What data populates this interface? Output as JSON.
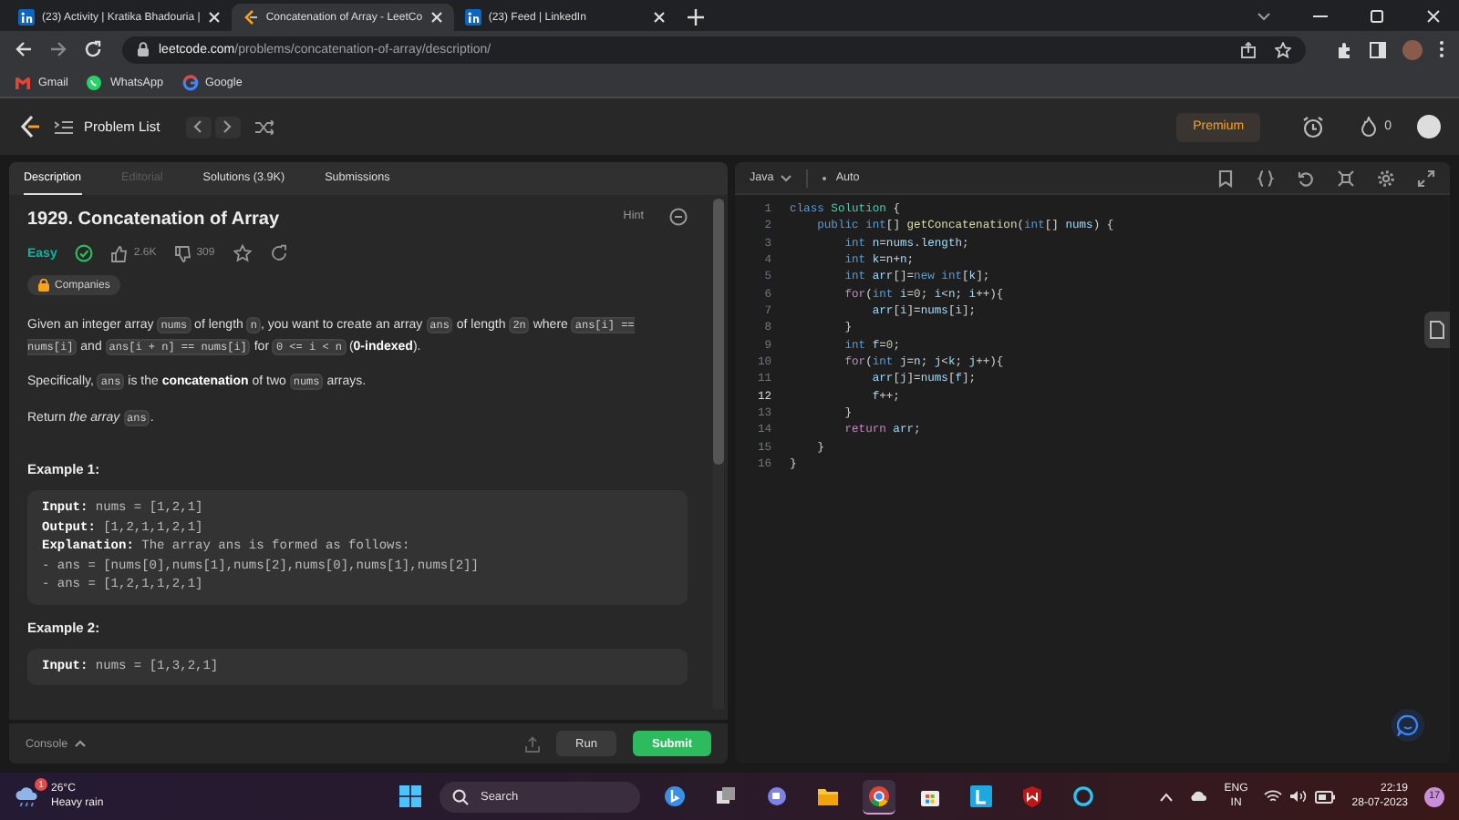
{
  "browser": {
    "tabs": [
      {
        "title": "(23) Activity | Kratika Bhadouria |",
        "kind": "linkedin",
        "selected": false
      },
      {
        "title": "Concatenation of Array - LeetCo",
        "kind": "leetcode",
        "selected": true
      },
      {
        "title": "(23) Feed | LinkedIn",
        "kind": "linkedin",
        "selected": false
      }
    ],
    "url": {
      "host": "leetcode.com",
      "path": "/problems/concatenation-of-array/description/"
    },
    "bookmarks": [
      {
        "label": "Gmail",
        "kind": "gmail"
      },
      {
        "label": "WhatsApp",
        "kind": "whatsapp"
      },
      {
        "label": "Google",
        "kind": "google"
      }
    ]
  },
  "nav": {
    "problem_list": "Problem List",
    "premium": "Premium",
    "streak": "0"
  },
  "left_tabs": [
    {
      "label": "Description",
      "selected": true,
      "disabled": false
    },
    {
      "label": "Editorial",
      "selected": false,
      "disabled": true
    },
    {
      "label": "Solutions (3.9K)",
      "selected": false,
      "disabled": false
    },
    {
      "label": "Submissions",
      "selected": false,
      "disabled": false
    }
  ],
  "problem": {
    "title": "1929. Concatenation of Array",
    "hint": "Hint",
    "difficulty": "Easy",
    "solved": true,
    "likes": "2.6K",
    "dislikes": "309",
    "companies": "Companies",
    "paragraphs": [
      [
        {
          "kind": "text",
          "text": "Given an integer array "
        },
        {
          "kind": "code",
          "text": "nums"
        },
        {
          "kind": "text",
          "text": " of length "
        },
        {
          "kind": "code",
          "text": "n"
        },
        {
          "kind": "text",
          "text": ", you want to create an array "
        },
        {
          "kind": "code",
          "text": "ans"
        },
        {
          "kind": "text",
          "text": " of length "
        },
        {
          "kind": "code",
          "text": "2n"
        },
        {
          "kind": "text",
          "text": " where "
        },
        {
          "kind": "code",
          "text": "ans[i] == nums[i]"
        },
        {
          "kind": "text",
          "text": " and "
        },
        {
          "kind": "code",
          "text": "ans[i + n] == nums[i]"
        },
        {
          "kind": "text",
          "text": " for "
        },
        {
          "kind": "code",
          "text": "0 <= i < n"
        },
        {
          "kind": "text",
          "text": " ("
        },
        {
          "kind": "bold",
          "text": "0-indexed"
        },
        {
          "kind": "text",
          "text": ")."
        }
      ],
      [
        {
          "kind": "text",
          "text": "Specifically, "
        },
        {
          "kind": "code",
          "text": "ans"
        },
        {
          "kind": "text",
          "text": " is the "
        },
        {
          "kind": "bold",
          "text": "concatenation"
        },
        {
          "kind": "text",
          "text": " of two "
        },
        {
          "kind": "code",
          "text": "nums"
        },
        {
          "kind": "text",
          "text": " arrays."
        }
      ],
      [
        {
          "kind": "text",
          "text": "Return "
        },
        {
          "kind": "italic",
          "text": "the array "
        },
        {
          "kind": "code",
          "text": "ans"
        },
        {
          "kind": "text",
          "text": "."
        }
      ]
    ],
    "examples": [
      {
        "title": "Example 1:",
        "lines": [
          {
            "label": "Input:",
            "text": "nums = [1,2,1]"
          },
          {
            "label": "Output:",
            "text": "[1,2,1,1,2,1]"
          },
          {
            "label": "Explanation:",
            "text": "The array ans is formed as follows:"
          },
          {
            "text": "- ans = [nums[0],nums[1],nums[2],nums[0],nums[1],nums[2]]"
          },
          {
            "text": "- ans = [1,2,1,1,2,1]"
          }
        ]
      },
      {
        "title": "Example 2:",
        "lines": [
          {
            "label": "Input:",
            "text": "nums = [1,3,2,1]"
          }
        ]
      }
    ]
  },
  "console": {
    "label": "Console",
    "run": "Run",
    "submit": "Submit"
  },
  "editor": {
    "language": "Java",
    "mode": "Auto",
    "lines": [
      {
        "number": "1",
        "current": false,
        "tokens": [
          {
            "kind": "keyword",
            "text": "class"
          },
          {
            "kind": "type",
            "text": " Solution"
          },
          {
            "kind": "plain",
            "text": " {"
          }
        ]
      },
      {
        "number": "2",
        "current": false,
        "tokens": [
          {
            "kind": "keyword",
            "text": "    public"
          },
          {
            "kind": "keyword",
            "text": " int"
          },
          {
            "kind": "plain",
            "text": "[] "
          },
          {
            "kind": "function",
            "text": "getConcatenation"
          },
          {
            "kind": "plain",
            "text": "("
          },
          {
            "kind": "keyword",
            "text": "int"
          },
          {
            "kind": "plain",
            "text": "[] "
          },
          {
            "kind": "variable",
            "text": "nums"
          },
          {
            "kind": "plain",
            "text": ") {"
          }
        ]
      },
      {
        "number": "3",
        "current": false,
        "tokens": [
          {
            "kind": "keyword",
            "text": "        int"
          },
          {
            "kind": "variable",
            "text": " n"
          },
          {
            "kind": "plain",
            "text": "="
          },
          {
            "kind": "variable",
            "text": "nums"
          },
          {
            "kind": "plain",
            "text": "."
          },
          {
            "kind": "variable",
            "text": "length"
          },
          {
            "kind": "plain",
            "text": ";"
          }
        ]
      },
      {
        "number": "4",
        "current": false,
        "tokens": [
          {
            "kind": "keyword",
            "text": "        int"
          },
          {
            "kind": "variable",
            "text": " k"
          },
          {
            "kind": "plain",
            "text": "="
          },
          {
            "kind": "variable",
            "text": "n"
          },
          {
            "kind": "plain",
            "text": "+"
          },
          {
            "kind": "variable",
            "text": "n"
          },
          {
            "kind": "plain",
            "text": ";"
          }
        ]
      },
      {
        "number": "5",
        "current": false,
        "tokens": [
          {
            "kind": "keyword",
            "text": "        int"
          },
          {
            "kind": "variable",
            "text": " arr"
          },
          {
            "kind": "plain",
            "text": "[]="
          },
          {
            "kind": "keyword",
            "text": "new"
          },
          {
            "kind": "keyword",
            "text": " int"
          },
          {
            "kind": "plain",
            "text": "["
          },
          {
            "kind": "variable",
            "text": "k"
          },
          {
            "kind": "plain",
            "text": "];"
          }
        ]
      },
      {
        "number": "6",
        "current": false,
        "tokens": [
          {
            "kind": "control",
            "text": "        for"
          },
          {
            "kind": "plain",
            "text": "("
          },
          {
            "kind": "keyword",
            "text": "int"
          },
          {
            "kind": "variable",
            "text": " i"
          },
          {
            "kind": "plain",
            "text": "="
          },
          {
            "kind": "number",
            "text": "0"
          },
          {
            "kind": "plain",
            "text": "; "
          },
          {
            "kind": "variable",
            "text": "i"
          },
          {
            "kind": "plain",
            "text": "<"
          },
          {
            "kind": "variable",
            "text": "n"
          },
          {
            "kind": "plain",
            "text": "; "
          },
          {
            "kind": "variable",
            "text": "i"
          },
          {
            "kind": "plain",
            "text": "++){"
          }
        ]
      },
      {
        "number": "7",
        "current": false,
        "tokens": [
          {
            "kind": "variable",
            "text": "            arr"
          },
          {
            "kind": "plain",
            "text": "["
          },
          {
            "kind": "variable",
            "text": "i"
          },
          {
            "kind": "plain",
            "text": "]="
          },
          {
            "kind": "variable",
            "text": "nums"
          },
          {
            "kind": "plain",
            "text": "["
          },
          {
            "kind": "variable",
            "text": "i"
          },
          {
            "kind": "plain",
            "text": "];"
          }
        ]
      },
      {
        "number": "8",
        "current": false,
        "tokens": [
          {
            "kind": "plain",
            "text": "        }"
          }
        ]
      },
      {
        "number": "9",
        "current": false,
        "tokens": [
          {
            "kind": "keyword",
            "text": "        int"
          },
          {
            "kind": "variable",
            "text": " f"
          },
          {
            "kind": "plain",
            "text": "="
          },
          {
            "kind": "number",
            "text": "0"
          },
          {
            "kind": "plain",
            "text": ";"
          }
        ]
      },
      {
        "number": "10",
        "current": false,
        "tokens": [
          {
            "kind": "control",
            "text": "        for"
          },
          {
            "kind": "plain",
            "text": "("
          },
          {
            "kind": "keyword",
            "text": "int"
          },
          {
            "kind": "variable",
            "text": " j"
          },
          {
            "kind": "plain",
            "text": "="
          },
          {
            "kind": "variable",
            "text": "n"
          },
          {
            "kind": "plain",
            "text": "; "
          },
          {
            "kind": "variable",
            "text": "j"
          },
          {
            "kind": "plain",
            "text": "<"
          },
          {
            "kind": "variable",
            "text": "k"
          },
          {
            "kind": "plain",
            "text": "; "
          },
          {
            "kind": "variable",
            "text": "j"
          },
          {
            "kind": "plain",
            "text": "++){"
          }
        ]
      },
      {
        "number": "11",
        "current": false,
        "tokens": [
          {
            "kind": "variable",
            "text": "            arr"
          },
          {
            "kind": "plain",
            "text": "["
          },
          {
            "kind": "variable",
            "text": "j"
          },
          {
            "kind": "plain",
            "text": "]="
          },
          {
            "kind": "variable",
            "text": "nums"
          },
          {
            "kind": "plain",
            "text": "["
          },
          {
            "kind": "variable",
            "text": "f"
          },
          {
            "kind": "plain",
            "text": "];"
          }
        ]
      },
      {
        "number": "12",
        "current": true,
        "tokens": [
          {
            "kind": "variable",
            "text": "            f"
          },
          {
            "kind": "plain",
            "text": "++;"
          }
        ]
      },
      {
        "number": "13",
        "current": false,
        "tokens": [
          {
            "kind": "plain",
            "text": "        }"
          }
        ]
      },
      {
        "number": "14",
        "current": false,
        "tokens": [
          {
            "kind": "control",
            "text": "        return"
          },
          {
            "kind": "variable",
            "text": " arr"
          },
          {
            "kind": "plain",
            "text": ";"
          }
        ]
      },
      {
        "number": "15",
        "current": false,
        "tokens": [
          {
            "kind": "plain",
            "text": "    }"
          }
        ]
      },
      {
        "number": "16",
        "current": false,
        "tokens": [
          {
            "kind": "plain",
            "text": "}"
          }
        ]
      }
    ]
  },
  "taskbar": {
    "weather": {
      "temp": "26°C",
      "condition": "Heavy rain",
      "badge": "1"
    },
    "search": "Search",
    "apps": [
      {
        "kind": "bing",
        "selected": false
      },
      {
        "kind": "taskview",
        "selected": false
      },
      {
        "kind": "chat",
        "selected": false
      },
      {
        "kind": "folder",
        "selected": false
      },
      {
        "kind": "chrome",
        "selected": true
      },
      {
        "kind": "store",
        "selected": false
      },
      {
        "kind": "lapp",
        "selected": false
      },
      {
        "kind": "shield",
        "selected": false
      },
      {
        "kind": "ring",
        "selected": false
      }
    ],
    "language": "ENG",
    "region": "IN",
    "time": "22:19",
    "date": "28-07-2023",
    "notifications": "17"
  }
}
